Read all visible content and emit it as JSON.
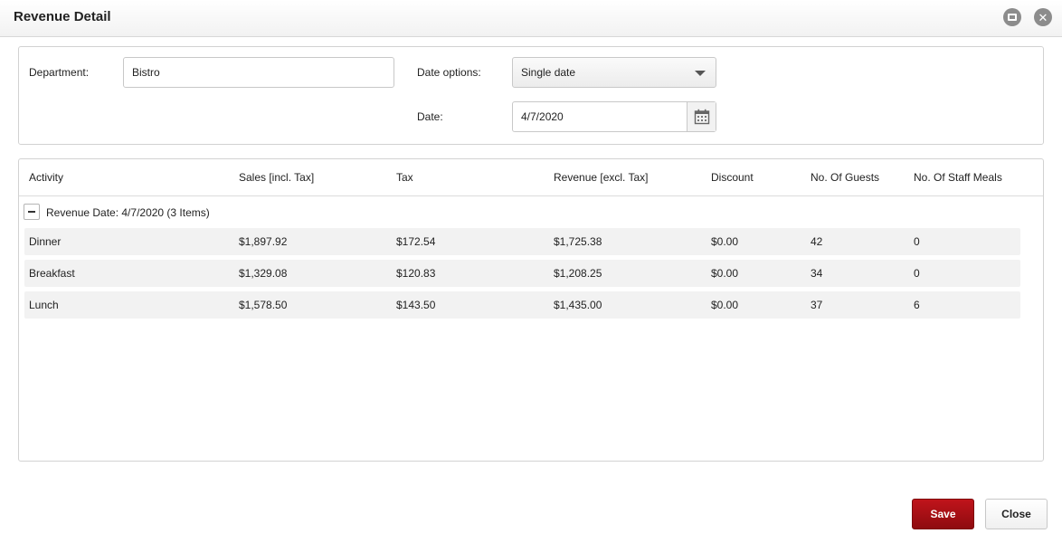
{
  "window": {
    "title": "Revenue Detail"
  },
  "filters": {
    "department_label": "Department:",
    "department_value": "Bistro",
    "date_options_label": "Date options:",
    "date_options_value": "Single date",
    "date_label": "Date:",
    "date_value": "4/7/2020"
  },
  "grid": {
    "columns": [
      "Activity",
      "Sales [incl. Tax]",
      "Tax",
      "Revenue [excl. Tax]",
      "Discount",
      "No. Of Guests",
      "No. Of Staff Meals"
    ],
    "group_label": "Revenue Date: 4/7/2020 (3 Items)",
    "rows": [
      [
        "Dinner",
        "$1,897.92",
        "$172.54",
        "$1,725.38",
        "$0.00",
        "42",
        "0"
      ],
      [
        "Breakfast",
        "$1,329.08",
        "$120.83",
        "$1,208.25",
        "$0.00",
        "34",
        "0"
      ],
      [
        "Lunch",
        "$1,578.50",
        "$143.50",
        "$1,435.00",
        "$0.00",
        "37",
        "6"
      ]
    ]
  },
  "footer": {
    "save_label": "Save",
    "close_label": "Close"
  },
  "colors": {
    "accent_save": "#b01016"
  },
  "icons": {
    "restore": "restore-window-icon",
    "close": "close-window-icon",
    "calendar": "calendar-icon",
    "collapse": "collapse-group-icon"
  }
}
